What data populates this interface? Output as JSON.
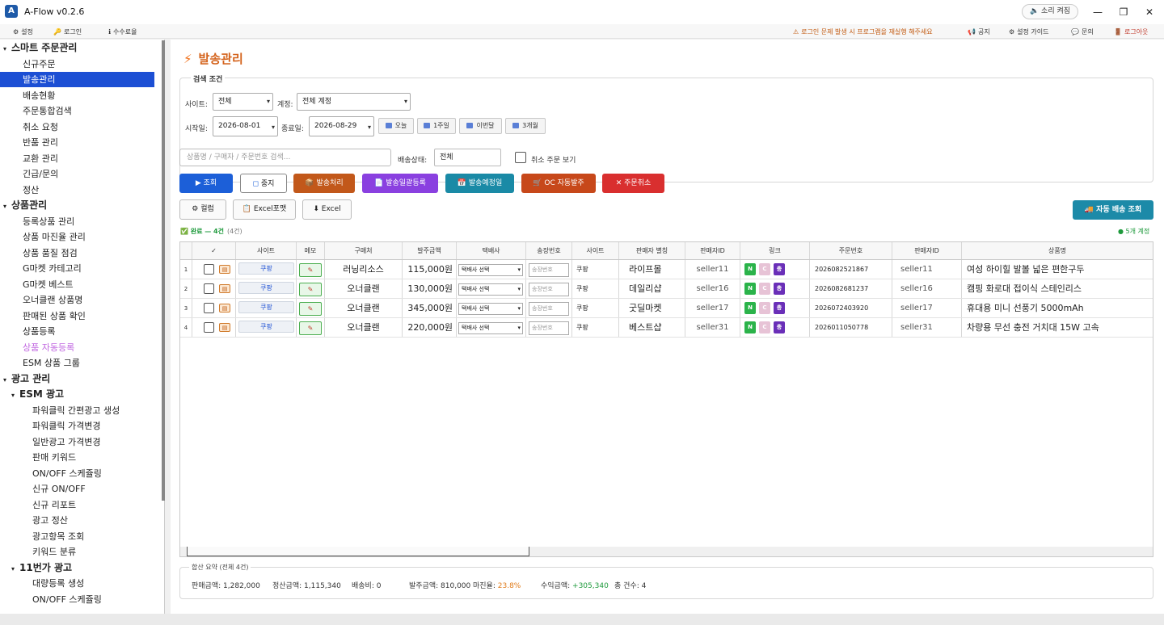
{
  "app": {
    "title": "A-Flow v0.2.6",
    "sound_btn": "🔈 소리 켜짐"
  },
  "menubar": {
    "left": [
      {
        "label": "설정",
        "icon": "⚙"
      },
      {
        "label": "로그인",
        "icon": "🔑"
      },
      {
        "label": "수수료율",
        "icon": "ℹ"
      }
    ],
    "notice": "로그인 문제 발생 시 프로그램을 재실행 해주세요",
    "right": [
      {
        "label": "공지",
        "icon": "📢"
      },
      {
        "label": "설정 가이드",
        "icon": "⚙"
      },
      {
        "label": "문의",
        "icon": "💬"
      },
      {
        "label": "로그아웃",
        "icon": "🚪"
      }
    ]
  },
  "sidebar": {
    "items": [
      {
        "label": "스마트 주문관리",
        "level": "h1"
      },
      {
        "label": "신규주문",
        "level": "l1"
      },
      {
        "label": "발송관리",
        "level": "l1",
        "active": true
      },
      {
        "label": "배송현황",
        "level": "l1"
      },
      {
        "label": "주문통합검색",
        "level": "l1"
      },
      {
        "label": "취소 요청",
        "level": "l1"
      },
      {
        "label": "반품 관리",
        "level": "l1"
      },
      {
        "label": "교환 관리",
        "level": "l1"
      },
      {
        "label": "긴급/문의",
        "level": "l1"
      },
      {
        "label": "정산",
        "level": "l1"
      },
      {
        "label": "상품관리",
        "level": "h1"
      },
      {
        "label": "등록상품 관리",
        "level": "l1"
      },
      {
        "label": "상품 마진율 관리",
        "level": "l1"
      },
      {
        "label": "상품 품질 점검",
        "level": "l1"
      },
      {
        "label": "G마켓 카테고리",
        "level": "l1"
      },
      {
        "label": "G마켓 베스트",
        "level": "l1"
      },
      {
        "label": "오너클랜 상품명",
        "level": "l1"
      },
      {
        "label": "판매된 상품 확인",
        "level": "l1"
      },
      {
        "label": "상품등록",
        "level": "l1"
      },
      {
        "label": "상품 자동등록",
        "level": "l1",
        "pink": true
      },
      {
        "label": "ESM 상품 그룹",
        "level": "l1"
      },
      {
        "label": "광고 관리",
        "level": "h1"
      },
      {
        "label": "ESM 광고",
        "level": "h2"
      },
      {
        "label": "파워클릭 간편광고 생성",
        "level": "l2"
      },
      {
        "label": "파워클릭 가격변경",
        "level": "l2"
      },
      {
        "label": "일반광고 가격변경",
        "level": "l2"
      },
      {
        "label": "판매 키워드",
        "level": "l2"
      },
      {
        "label": "ON/OFF 스케쥴링",
        "level": "l2"
      },
      {
        "label": "신규 ON/OFF",
        "level": "l2"
      },
      {
        "label": "신규 리포트",
        "level": "l2"
      },
      {
        "label": "광고 정산",
        "level": "l2"
      },
      {
        "label": "광고항목 조회",
        "level": "l2"
      },
      {
        "label": "키워드 분류",
        "level": "l2"
      },
      {
        "label": "11번가 광고",
        "level": "h2"
      },
      {
        "label": "대량등록 생성",
        "level": "l2"
      },
      {
        "label": "ON/OFF 스케쥴링",
        "level": "l2"
      }
    ]
  },
  "page": {
    "title": "발송관리"
  },
  "filters": {
    "legend": "검색 조건",
    "site_label": "사이트:",
    "site_value": "전체",
    "account_label": "계정:",
    "account_value": "전체 계정",
    "start_label": "시작일:",
    "start_value": "2026-08-01",
    "end_label": "종료일:",
    "end_value": "2026-08-29",
    "quick": [
      "오늘",
      "1주일",
      "이번달",
      "3개월"
    ],
    "search_placeholder": "상품명 / 구매자 / 주문번호 검색...",
    "status_label": "배송상태:",
    "status_value": "전체",
    "cancel_label": "취소 주문 보기"
  },
  "actions": [
    {
      "label": "조회",
      "icon": "▶",
      "color": "#1c5fd8"
    },
    {
      "label": "중지",
      "icon": "◻",
      "color": "#ffffff"
    },
    {
      "label": "발송처리",
      "icon": "📦",
      "color": "#c2581a"
    },
    {
      "label": "발송일괄등록",
      "icon": "📄",
      "color": "#8a40e0"
    },
    {
      "label": "발송예정일",
      "icon": "📅",
      "color": "#1a8aa6"
    },
    {
      "label": "OC 자동발주",
      "icon": "🛒",
      "color": "#c7481a"
    },
    {
      "label": "주문취소",
      "icon": "✕",
      "color": "#d92f2f"
    }
  ],
  "secondary": [
    {
      "label": "컬럼",
      "icon": "⚙"
    },
    {
      "label": "Excel포맷",
      "icon": "📋"
    },
    {
      "label": "Excel",
      "icon": "⬇"
    }
  ],
  "auto_ship": "🚚 자동 배송 조회",
  "result": {
    "status": "✅ 완료 — 4건",
    "count": "(4건)",
    "accounts": "● 5개 계정"
  },
  "table": {
    "headers": [
      "",
      "✓",
      "사이트",
      "메모",
      "구매처",
      "발주금액",
      "택배사",
      "송장번호",
      "사이트",
      "판매자 별칭",
      "판매자ID",
      "링크",
      "주문번호",
      "판매자ID",
      "상품명"
    ],
    "courier_placeholder": "택배사 선택",
    "invoice_placeholder": "송장번호",
    "link_labels": [
      "N",
      "C",
      "총"
    ],
    "rows": [
      {
        "num": "1",
        "site": "쿠팡",
        "buyer": "러닝리소스",
        "amount": "115,000원",
        "site2": "쿠팡",
        "alias": "라이프몰",
        "sid": "seller11",
        "order": "2026082521867",
        "sid2": "seller11",
        "product": "여성 하이힐 발볼 넓은 편한구두"
      },
      {
        "num": "2",
        "site": "쿠팡",
        "buyer": "오너클랜",
        "amount": "130,000원",
        "site2": "쿠팡",
        "alias": "데일리샵",
        "sid": "seller16",
        "order": "2026082681237",
        "sid2": "seller16",
        "product": "캠핑 화로대 접이식 스테인리스"
      },
      {
        "num": "3",
        "site": "쿠팡",
        "buyer": "오너클랜",
        "amount": "345,000원",
        "site2": "쿠팡",
        "alias": "굿딜마켓",
        "sid": "seller17",
        "order": "2026072403920",
        "sid2": "seller17",
        "product": "휴대용 미니 선풍기 5000mAh"
      },
      {
        "num": "4",
        "site": "쿠팡",
        "buyer": "오너클랜",
        "amount": "220,000원",
        "site2": "쿠팡",
        "alias": "베스트샵",
        "sid": "seller31",
        "order": "2026011050778",
        "sid2": "seller31",
        "product": "차량용 무선 충전 거치대 15W 고속"
      }
    ]
  },
  "summary": {
    "legend": "합산 요약 (전체 4건)",
    "items": [
      {
        "label": "판매금액:",
        "value": "1,282,000",
        "color": "#333333"
      },
      {
        "label": "정산금액:",
        "value": "1,115,340",
        "color": "#333333"
      },
      {
        "label": "배송비:",
        "value": "0",
        "color": "#333333"
      },
      {
        "label": "발주금액:",
        "value": "810,000",
        "color": "#333333"
      },
      {
        "label": "마진율:",
        "value": "23.8%",
        "color": "#e07b1a"
      },
      {
        "label": "수익금액:",
        "value": "+305,340",
        "color": "#1e9a3c"
      },
      {
        "label": "총 건수:",
        "value": "4",
        "color": "#333333"
      }
    ]
  }
}
